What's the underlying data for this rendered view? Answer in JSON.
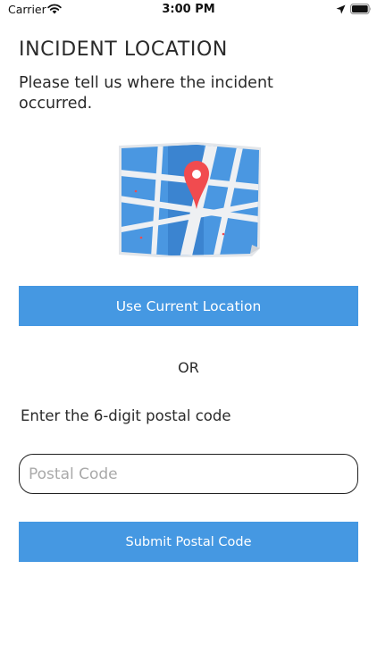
{
  "status_bar": {
    "carrier": "Carrier",
    "time": "3:00 PM",
    "icons": [
      "wifi-icon",
      "location-arrow-icon",
      "battery-icon"
    ]
  },
  "header": {
    "title": "INCIDENT LOCATION",
    "subtitle": "Please tell us where the incident occurred."
  },
  "illustration": {
    "icon": "map-pin-illustration",
    "colors": {
      "map_blue": "#4a97e1",
      "roads": "#eef0f3",
      "pin": "#f14b4f"
    }
  },
  "actions": {
    "use_location_label": "Use Current Location",
    "or_label": "OR",
    "postal_prompt": "Enter the 6-digit postal code",
    "postal_placeholder": "Postal Code",
    "postal_value": "",
    "submit_label": "Submit Postal Code"
  },
  "colors": {
    "accent": "#4598e2",
    "text": "#2a2a2a"
  }
}
